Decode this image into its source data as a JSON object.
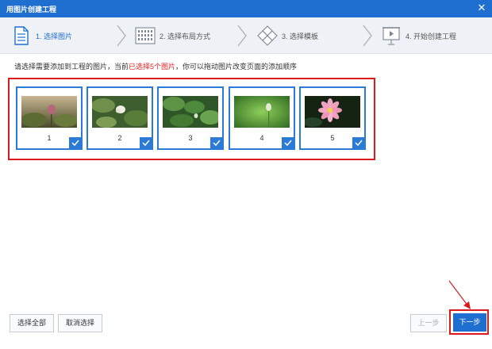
{
  "window": {
    "title": "用图片创建工程",
    "close_glyph": "✕"
  },
  "steps": [
    {
      "label": "1. 选择图片",
      "icon": "document-icon",
      "active": true
    },
    {
      "label": "2. 选择布局方式",
      "icon": "grid-layout-icon",
      "active": false
    },
    {
      "label": "3. 选择模板",
      "icon": "template-diamond-icon",
      "active": false
    },
    {
      "label": "4. 开始创建工程",
      "icon": "play-board-icon",
      "active": false
    }
  ],
  "instruction": {
    "before": "请选择需要添加到工程的图片，当前",
    "highlight": "已选择5个图片",
    "after": "，你可以拖动图片改变页面的添加顺序",
    "highlight_color": "#e02020"
  },
  "thumbnails": [
    {
      "number": "1",
      "selected": true
    },
    {
      "number": "2",
      "selected": true
    },
    {
      "number": "3",
      "selected": true
    },
    {
      "number": "4",
      "selected": true
    },
    {
      "number": "5",
      "selected": true
    }
  ],
  "buttons": {
    "select_all": "选择全部",
    "deselect": "取消选择",
    "prev": "上一步",
    "next": "下一步"
  },
  "colors": {
    "accent": "#1e6fd0",
    "annotation": "#d91b1b"
  }
}
